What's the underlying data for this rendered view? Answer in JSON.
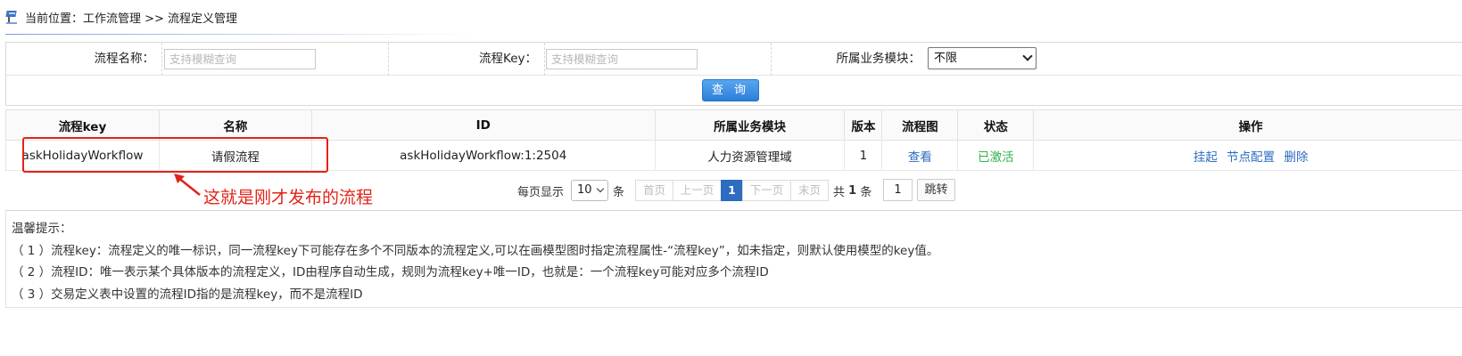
{
  "breadcrumb": {
    "text": "当前位置：工作流管理 >> 流程定义管理",
    "icon": "breadcrumb-location-icon"
  },
  "search": {
    "name_label": "流程名称：",
    "name_placeholder": "支持模糊查询",
    "key_label": "流程Key：",
    "key_placeholder": "支持模糊查询",
    "module_label": "所属业务模块：",
    "module_selected": "不限",
    "query_button": "查 询"
  },
  "table": {
    "headers": [
      "流程key",
      "名称",
      "ID",
      "所属业务模块",
      "版本",
      "流程图",
      "状态",
      "操作"
    ],
    "rows": [
      {
        "key": "askHolidayWorkflow",
        "name": "请假流程",
        "id": "askHolidayWorkflow:1:2504",
        "module": "人力资源管理域",
        "version": "1",
        "diagram": "查看",
        "status": "已激活",
        "actions": [
          "挂起",
          "节点配置",
          "删除"
        ]
      }
    ]
  },
  "annotation": {
    "text": "这就是刚才发布的流程",
    "color": "#e2231a"
  },
  "pagination": {
    "per_page_label": "每页显示",
    "per_page_value": "10",
    "unit": "条",
    "first": "首页",
    "prev": "上一页",
    "current": "1",
    "next": "下一页",
    "last": "末页",
    "total_prefix": "共",
    "total": "1",
    "total_suffix": "条",
    "goto_value": "1",
    "goto_button": "跳转"
  },
  "tips": {
    "title": "温馨提示：",
    "lines": [
      "（ 1 ）流程key：流程定义的唯一标识，同一流程key下可能存在多个不同版本的流程定义,可以在画模型图时指定流程属性-“流程key”，如未指定，则默认使用模型的key值。",
      "（ 2 ）流程ID：唯一表示某个具体版本的流程定义，ID由程序自动生成，规则为流程key+唯一ID，也就是：一个流程key可能对应多个流程ID",
      "（ 3 ）交易定义表中设置的流程ID指的是流程key，而不是流程ID"
    ]
  },
  "colors": {
    "link": "#2d6cc0",
    "active_status": "#2fb34a",
    "annotation": "#e2231a",
    "button": "#2c7fd8"
  }
}
